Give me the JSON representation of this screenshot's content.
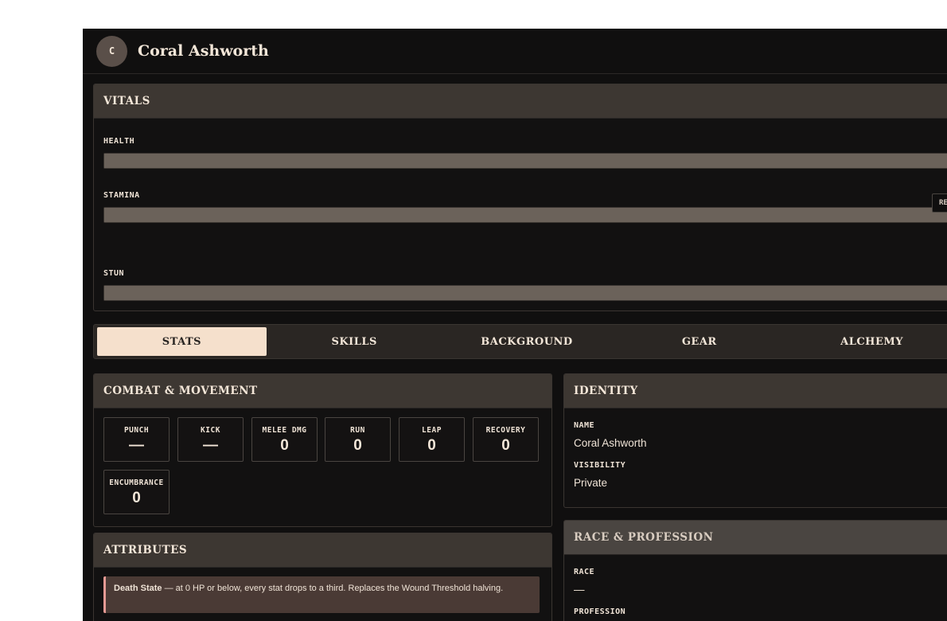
{
  "header": {
    "avatar_initial": "C",
    "name": "Coral Ashworth"
  },
  "vitals": {
    "title": "VITALS",
    "reset_label": "RESET",
    "bars": [
      {
        "label": "HEALTH",
        "fill": 1.0
      },
      {
        "label": "STAMINA",
        "fill": 1.0
      },
      {
        "label": "STUN",
        "fill": 1.0
      }
    ]
  },
  "tabs": [
    "STATS",
    "SKILLS",
    "BACKGROUND",
    "GEAR",
    "ALCHEMY"
  ],
  "active_tab": "STATS",
  "combat": {
    "title": "COMBAT & MOVEMENT",
    "stats": [
      {
        "label": "PUNCH",
        "value": "—"
      },
      {
        "label": "KICK",
        "value": "—"
      },
      {
        "label": "MELEE DMG",
        "value": "0"
      },
      {
        "label": "RUN",
        "value": "0"
      },
      {
        "label": "LEAP",
        "value": "0"
      },
      {
        "label": "RECOVERY",
        "value": "0"
      },
      {
        "label": "ENCUMBRANCE",
        "value": "0"
      }
    ]
  },
  "attributes": {
    "title": "ATTRIBUTES",
    "notice_bold": "Death State",
    "notice_text": " — at 0 HP or below, every stat drops to a third. Replaces the Wound Threshold halving."
  },
  "identity": {
    "title": "IDENTITY",
    "name_label": "NAME",
    "name_value": "Coral Ashworth",
    "visibility_label": "VISIBILITY",
    "visibility_value": "Private"
  },
  "race_profession": {
    "title": "RACE & PROFESSION",
    "race_label": "RACE",
    "race_value": "—",
    "profession_label": "PROFESSION"
  },
  "colors": {
    "background": "#100f0f",
    "panel_header": "#3d3732",
    "accent_tab": "#f5e0cc",
    "text": "#f3e6d8",
    "bar": "#6b625a",
    "notice_border": "#e59a94"
  }
}
